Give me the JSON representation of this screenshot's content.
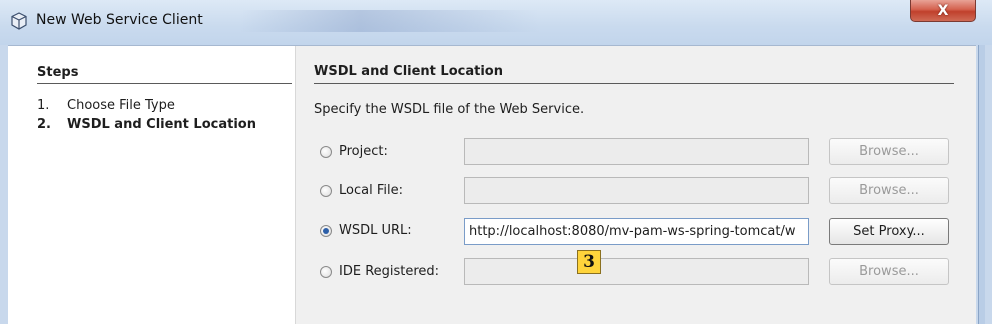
{
  "window": {
    "title": "New Web Service Client",
    "close_glyph": "X"
  },
  "steps": {
    "title": "Steps",
    "items": [
      {
        "num": "1.",
        "label": "Choose File Type"
      },
      {
        "num": "2.",
        "label": "WSDL and Client Location"
      }
    ],
    "current_index": 1
  },
  "main": {
    "section_title": "WSDL and Client Location",
    "description": "Specify the WSDL file of the Web Service.",
    "options": [
      {
        "label": "Project:",
        "selected": false,
        "value": "",
        "button": "Browse...",
        "button_enabled": false
      },
      {
        "label": "Local File:",
        "selected": false,
        "value": "",
        "button": "Browse...",
        "button_enabled": false
      },
      {
        "label": "WSDL URL:",
        "selected": true,
        "value": "http://localhost:8080/mv-pam-ws-spring-tomcat/w",
        "button": "Set Proxy...",
        "button_enabled": true
      },
      {
        "label": "IDE Registered:",
        "selected": false,
        "value": "",
        "button": "Browse...",
        "button_enabled": false
      }
    ]
  },
  "annotation": {
    "marker_label": "3",
    "marker_color": "#ffd43b"
  },
  "colors": {
    "titlebar": "#c9daee",
    "close_button": "#c0402c",
    "radio_selected": "#2d5fa8"
  }
}
